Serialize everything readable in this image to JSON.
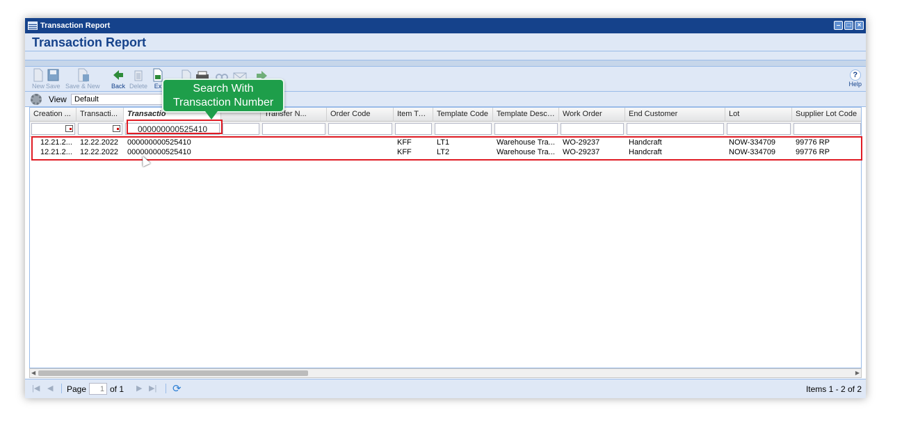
{
  "window": {
    "title": "Transaction Report",
    "heading": "Transaction Report",
    "controls": [
      "minimize-icon",
      "maximize-icon",
      "close-icon"
    ]
  },
  "toolbar": {
    "buttons": [
      {
        "label": "New",
        "icon": "new-document-icon",
        "enabled": false
      },
      {
        "label": "Save",
        "icon": "floppy-disk-icon",
        "enabled": false
      },
      {
        "label": "Save & New",
        "icon": "save-new-icon",
        "enabled": false
      },
      {
        "label": "Back",
        "icon": "back-arrow-icon",
        "enabled": true
      },
      {
        "label": "Delete",
        "icon": "trash-icon",
        "enabled": false
      },
      {
        "label": "Ex",
        "icon": "export-icon",
        "enabled": true
      }
    ],
    "help_label": "Help"
  },
  "viewbar": {
    "label": "View",
    "selected": "Default"
  },
  "grid": {
    "columns": [
      "Creation ...",
      "Transacti...",
      "Transactio",
      "Transfer N...",
      "Order Code",
      "Item Type",
      "Template Code",
      "Template Descr...",
      "Work Order",
      "End Customer",
      "Lot",
      "Supplier Lot Code"
    ],
    "filter": {
      "transaction_number": "000000000525410"
    },
    "rows": [
      [
        "12.21.2...",
        "12.22.2022",
        "000000000525410",
        "",
        "",
        "KFF",
        "LT1",
        "Warehouse Tra...",
        "WO-29237",
        "Handcraft",
        "NOW-334709",
        "99776 RP"
      ],
      [
        "12.21.2...",
        "12.22.2022",
        "000000000525410",
        "",
        "",
        "KFF",
        "LT2",
        "Warehouse Tra...",
        "WO-29237",
        "Handcraft",
        "NOW-334709",
        "99776 RP"
      ]
    ]
  },
  "pager": {
    "page_label": "Page",
    "page_value": "1",
    "of_label": "of 1",
    "items_text": "Items 1 - 2 of 2"
  },
  "callout": {
    "line1": "Search With",
    "line2": "Transaction Number",
    "color": "#1e9e4a"
  },
  "highlight_color": "#e01b24"
}
